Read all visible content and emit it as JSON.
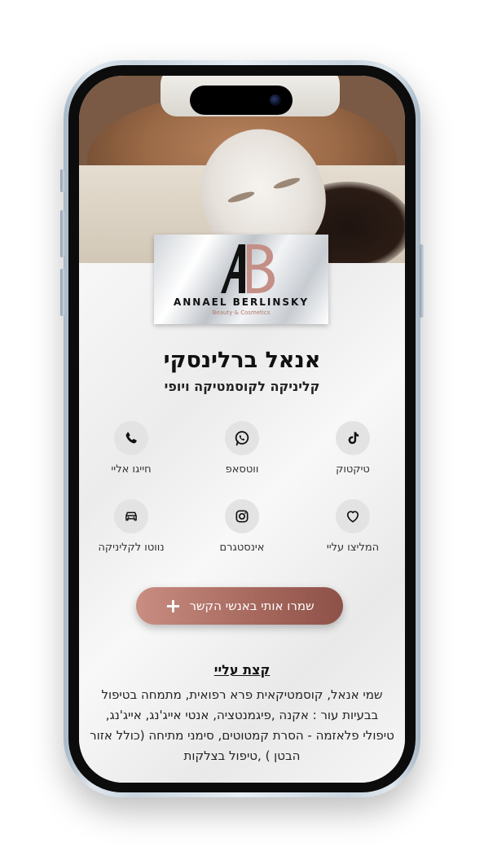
{
  "profile": {
    "name": "אנאל ברלינסקי",
    "tagline": "קליניקה לקוסמטיקה ויופי"
  },
  "logo": {
    "name": "ANNAEL BERLINSKY",
    "sub": "Beauty & Cosmetics",
    "accent_color": "#c48f86"
  },
  "actions": [
    {
      "label": "טיקטוק",
      "icon": "tiktok-icon"
    },
    {
      "label": "ווטסאפ",
      "icon": "whatsapp-icon"
    },
    {
      "label": "חייגו אליי",
      "icon": "phone-icon"
    },
    {
      "label": "המליצו עליי",
      "icon": "heart-icon"
    },
    {
      "label": "אינסטגרם",
      "icon": "instagram-icon"
    },
    {
      "label": "נווטו לקליניקה",
      "icon": "car-icon"
    }
  ],
  "save_button": {
    "label": "שמרו אותי באנשי הקשר",
    "icon": "plus-icon",
    "color": "#a86a5f"
  },
  "about": {
    "heading": "קצת עליי",
    "text": "שמי אנאל, קוסמטיקאית פרא רפואית, מתמחה בטיפול בבעיות עור : אקנה ,פיגמנטציה, אנטי אייג'נג, אייג'נג, טיפולי פלאזמה - הסרת קמטוטים, סימני מתיחה (כולל אזור הבטן ) ,טיפול בצלקות"
  }
}
